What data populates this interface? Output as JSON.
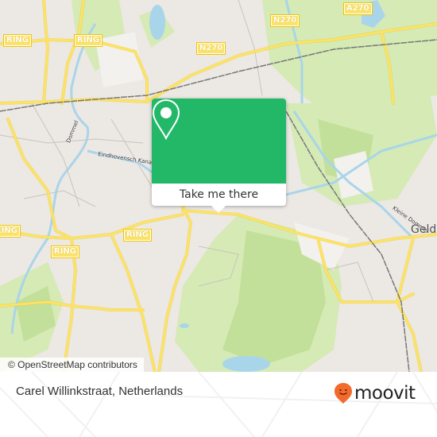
{
  "map": {
    "road_labels": [
      {
        "id": "ring-1",
        "text": "RING"
      },
      {
        "id": "ring-2",
        "text": "RING"
      },
      {
        "id": "ring-3",
        "text": "RING"
      },
      {
        "id": "ring-4",
        "text": "RING"
      },
      {
        "id": "ring-5",
        "text": "RING"
      },
      {
        "id": "n270-1",
        "text": "N270"
      },
      {
        "id": "n270-2",
        "text": "N270"
      },
      {
        "id": "a270",
        "text": "A270"
      }
    ],
    "place_labels": {
      "dommel": "Dommel",
      "eindhovensch_kanaal": "Eindhovensch Kanaal",
      "kleine_dommel": "Kleine Dommel",
      "geldrop": "Geldr"
    },
    "attribution": "© OpenStreetMap contributors",
    "colors": {
      "land": "#ece8e4",
      "park": "#cfe7a8",
      "water": "#a9d5ea",
      "road": "#fbe36a",
      "rail": "#777777"
    }
  },
  "popup": {
    "icon": "map-pin-icon",
    "cta_label": "Take me there",
    "accent": "#22b868"
  },
  "footer": {
    "address": "Carel Willinkstraat, Netherlands",
    "brand_name": "moovit",
    "brand_icon": "moovit-smiley-pin-icon",
    "brand_color": "#f26b2c"
  }
}
